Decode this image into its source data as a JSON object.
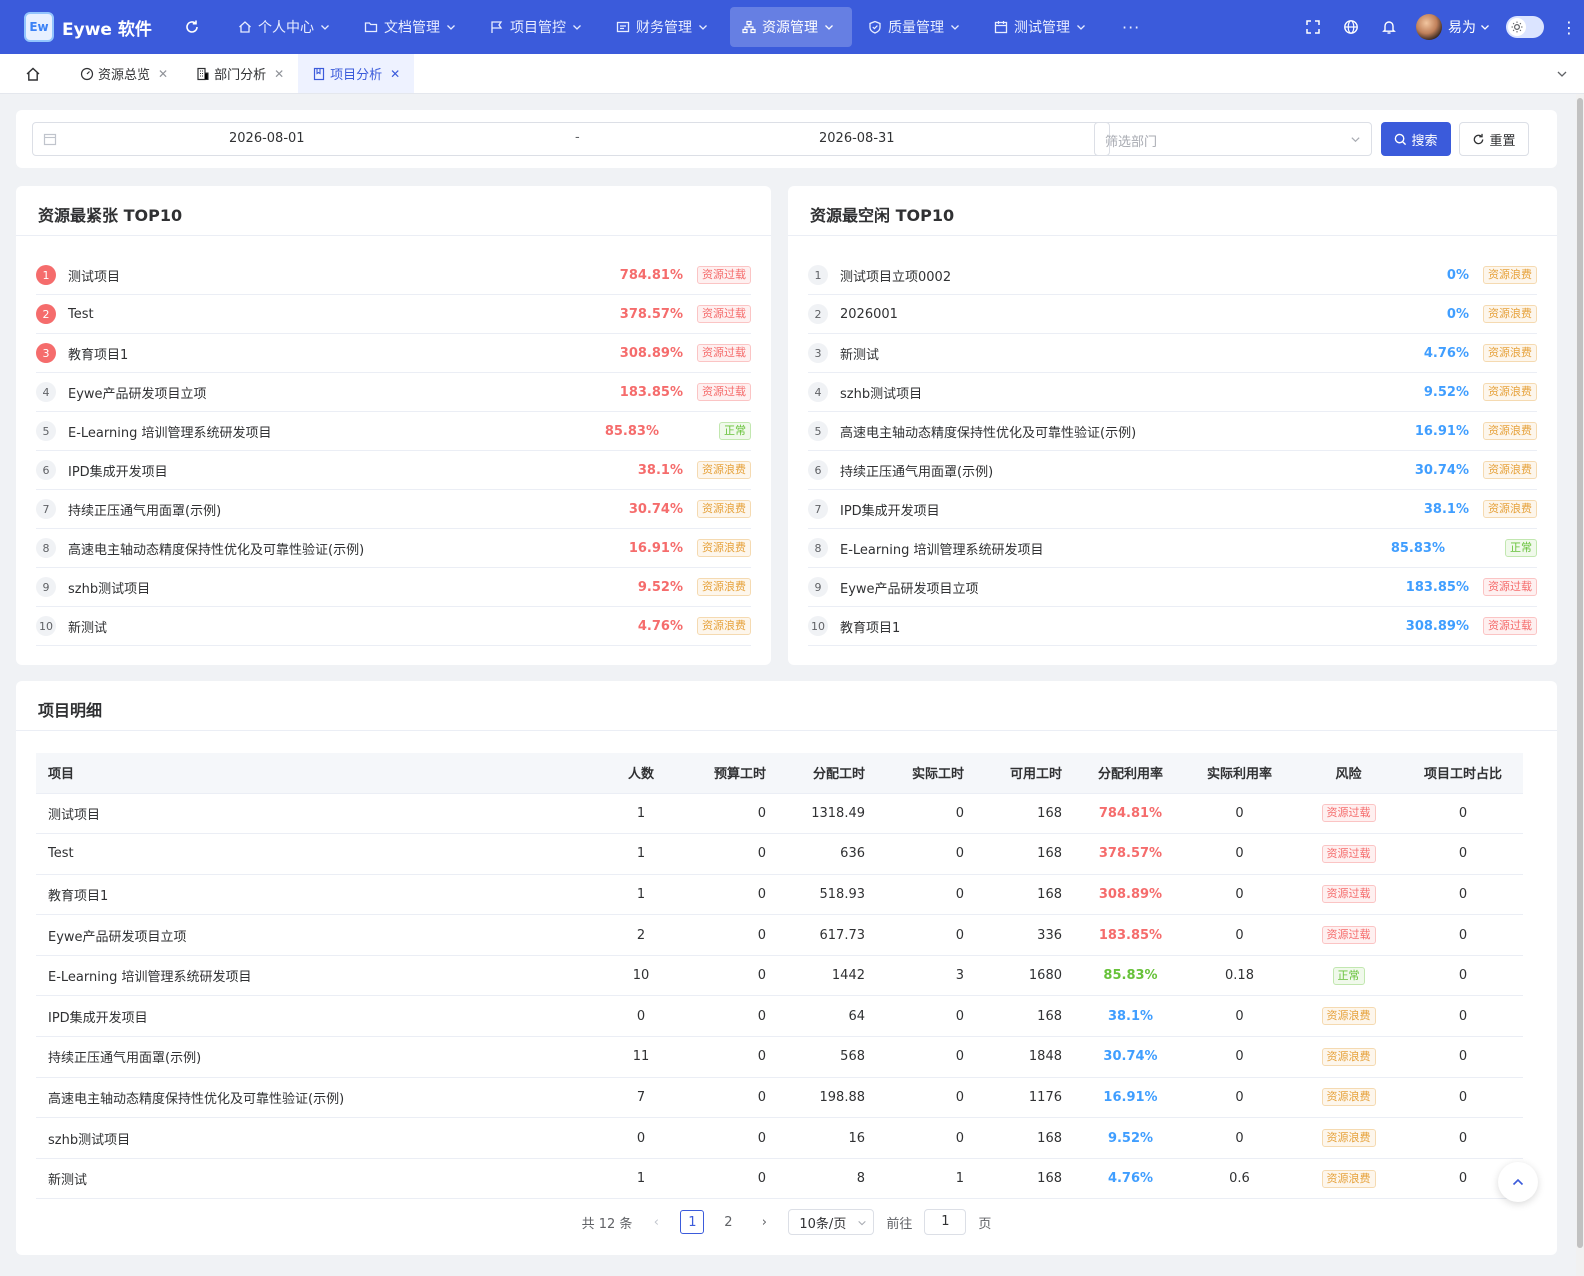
{
  "app": {
    "logo_mark": "Ew",
    "name": "Eywe 软件"
  },
  "nav": [
    {
      "label": "个人中心",
      "icon": "home-icon",
      "active": false
    },
    {
      "label": "文档管理",
      "icon": "folder-icon",
      "active": false
    },
    {
      "label": "项目管控",
      "icon": "flag-icon",
      "active": false
    },
    {
      "label": "财务管理",
      "icon": "finance-icon",
      "active": false
    },
    {
      "label": "资源管理",
      "icon": "sitemap-icon",
      "active": true
    },
    {
      "label": "质量管理",
      "icon": "shield-icon",
      "active": false
    },
    {
      "label": "测试管理",
      "icon": "calendar-icon",
      "active": false
    }
  ],
  "nav_more": "···",
  "user": {
    "name": "易为"
  },
  "tabs": [
    {
      "label": "资源总览",
      "icon": "dashboard-icon",
      "active": false
    },
    {
      "label": "部门分析",
      "icon": "building-icon",
      "active": false
    },
    {
      "label": "项目分析",
      "icon": "bookmark-icon",
      "active": true
    }
  ],
  "filter": {
    "start_date": "2026-08-01",
    "separator": "-",
    "end_date": "2026-08-31",
    "dept_placeholder": "筛选部门",
    "search_label": "搜索",
    "reset_label": "重置"
  },
  "tight": {
    "title": "资源最紧张 TOP10",
    "rows": [
      {
        "rank": "1",
        "name": "测试项目",
        "pct": "784.81%",
        "tag": "资源过载",
        "status": "over"
      },
      {
        "rank": "2",
        "name": "Test",
        "pct": "378.57%",
        "tag": "资源过载",
        "status": "over"
      },
      {
        "rank": "3",
        "name": "教育项目1",
        "pct": "308.89%",
        "tag": "资源过载",
        "status": "over"
      },
      {
        "rank": "4",
        "name": "Eywe产品研发项目立项",
        "pct": "183.85%",
        "tag": "资源过载",
        "status": "over"
      },
      {
        "rank": "5",
        "name": "E-Learning 培训管理系统研发项目",
        "pct": "85.83%",
        "tag": "正常",
        "status": "ok"
      },
      {
        "rank": "6",
        "name": "IPD集成开发项目",
        "pct": "38.1%",
        "tag": "资源浪费",
        "status": "waste"
      },
      {
        "rank": "7",
        "name": "持续正压通气用面罩(示例)",
        "pct": "30.74%",
        "tag": "资源浪费",
        "status": "waste"
      },
      {
        "rank": "8",
        "name": "高速电主轴动态精度保持性优化及可靠性验证(示例)",
        "pct": "16.91%",
        "tag": "资源浪费",
        "status": "waste"
      },
      {
        "rank": "9",
        "name": "szhb测试项目",
        "pct": "9.52%",
        "tag": "资源浪费",
        "status": "waste"
      },
      {
        "rank": "10",
        "name": "新测试",
        "pct": "4.76%",
        "tag": "资源浪费",
        "status": "waste"
      }
    ]
  },
  "idle": {
    "title": "资源最空闲 TOP10",
    "rows": [
      {
        "rank": "1",
        "name": "测试项目立项0002",
        "pct": "0%",
        "tag": "资源浪费",
        "status": "waste"
      },
      {
        "rank": "2",
        "name": "2026001",
        "pct": "0%",
        "tag": "资源浪费",
        "status": "waste"
      },
      {
        "rank": "3",
        "name": "新测试",
        "pct": "4.76%",
        "tag": "资源浪费",
        "status": "waste"
      },
      {
        "rank": "4",
        "name": "szhb测试项目",
        "pct": "9.52%",
        "tag": "资源浪费",
        "status": "waste"
      },
      {
        "rank": "5",
        "name": "高速电主轴动态精度保持性优化及可靠性验证(示例)",
        "pct": "16.91%",
        "tag": "资源浪费",
        "status": "waste"
      },
      {
        "rank": "6",
        "name": "持续正压通气用面罩(示例)",
        "pct": "30.74%",
        "tag": "资源浪费",
        "status": "waste"
      },
      {
        "rank": "7",
        "name": "IPD集成开发项目",
        "pct": "38.1%",
        "tag": "资源浪费",
        "status": "waste"
      },
      {
        "rank": "8",
        "name": "E-Learning 培训管理系统研发项目",
        "pct": "85.83%",
        "tag": "正常",
        "status": "ok"
      },
      {
        "rank": "9",
        "name": "Eywe产品研发项目立项",
        "pct": "183.85%",
        "tag": "资源过载",
        "status": "over"
      },
      {
        "rank": "10",
        "name": "教育项目1",
        "pct": "308.89%",
        "tag": "资源过载",
        "status": "over"
      }
    ]
  },
  "detail": {
    "title": "项目明细",
    "columns": [
      "项目",
      "人数",
      "预算工时",
      "分配工时",
      "实际工时",
      "可用工时",
      "分配利用率",
      "实际利用率",
      "风险",
      "项目工时占比"
    ],
    "rows": [
      [
        "测试项目",
        "1",
        "0",
        "1318.49",
        "0",
        "168",
        "784.81%",
        "0",
        "资源过载",
        "0"
      ],
      [
        "Test",
        "1",
        "0",
        "636",
        "0",
        "168",
        "378.57%",
        "0",
        "资源过载",
        "0"
      ],
      [
        "教育项目1",
        "1",
        "0",
        "518.93",
        "0",
        "168",
        "308.89%",
        "0",
        "资源过载",
        "0"
      ],
      [
        "Eywe产品研发项目立项",
        "2",
        "0",
        "617.73",
        "0",
        "336",
        "183.85%",
        "0",
        "资源过载",
        "0"
      ],
      [
        "E-Learning 培训管理系统研发项目",
        "10",
        "0",
        "1442",
        "3",
        "1680",
        "85.83%",
        "0.18",
        "正常",
        "0"
      ],
      [
        "IPD集成开发项目",
        "0",
        "0",
        "64",
        "0",
        "168",
        "38.1%",
        "0",
        "资源浪费",
        "0"
      ],
      [
        "持续正压通气用面罩(示例)",
        "11",
        "0",
        "568",
        "0",
        "1848",
        "30.74%",
        "0",
        "资源浪费",
        "0"
      ],
      [
        "高速电主轴动态精度保持性优化及可靠性验证(示例)",
        "7",
        "0",
        "198.88",
        "0",
        "1176",
        "16.91%",
        "0",
        "资源浪费",
        "0"
      ],
      [
        "szhb测试项目",
        "0",
        "0",
        "16",
        "0",
        "168",
        "9.52%",
        "0",
        "资源浪费",
        "0"
      ],
      [
        "新测试",
        "1",
        "0",
        "8",
        "1",
        "168",
        "4.76%",
        "0.6",
        "资源浪费",
        "0"
      ]
    ],
    "row_status": [
      "over",
      "over",
      "over",
      "over",
      "ok",
      "waste",
      "waste",
      "waste",
      "waste",
      "waste"
    ]
  },
  "pagination": {
    "total_text": "共 12 条",
    "pages": [
      "1",
      "2"
    ],
    "current": "1",
    "page_size": "10条/页",
    "goto_label": "前往",
    "goto_value": "1",
    "page_suffix": "页"
  },
  "colors": {
    "primary": "#3b5bdb",
    "over": "#f56c6c",
    "waste": "#e6a23c",
    "ok": "#67c23a",
    "blue_pct": "#409eff"
  }
}
